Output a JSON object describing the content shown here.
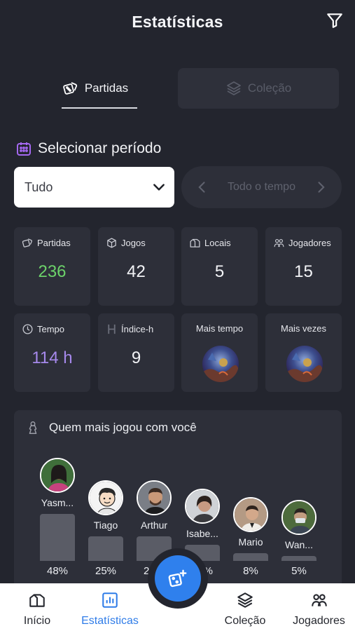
{
  "header": {
    "title": "Estatísticas"
  },
  "tabs": [
    {
      "label": "Partidas",
      "icon": "dice-icon",
      "active": true
    },
    {
      "label": "Coleção",
      "icon": "layers-icon",
      "active": false
    }
  ],
  "period": {
    "label": "Selecionar período",
    "select_value": "Tudo",
    "range_label": "Todo o tempo"
  },
  "stats": [
    {
      "label": "Partidas",
      "value": "236",
      "icon": "dice-icon",
      "color": "#6cd26a"
    },
    {
      "label": "Jogos",
      "value": "42",
      "icon": "box-icon"
    },
    {
      "label": "Locais",
      "value": "5",
      "icon": "location-icon"
    },
    {
      "label": "Jogadores",
      "value": "15",
      "icon": "players-icon"
    },
    {
      "label": "Tempo",
      "value": "114 h",
      "icon": "clock-icon",
      "color": "#a689ec"
    },
    {
      "label": "Índice-h",
      "value": "9",
      "icon": "h-icon"
    },
    {
      "label": "Mais tempo",
      "icon": "game-cover-image"
    },
    {
      "label": "Mais vezes",
      "icon": "game-cover-image"
    }
  ],
  "top_players": {
    "title": "Quem mais jogou com você",
    "players": [
      {
        "name": "Yasm...",
        "percent": "48%",
        "share": 0.48
      },
      {
        "name": "Tiago",
        "percent": "25%",
        "share": 0.25
      },
      {
        "name": "Arthur",
        "percent": "25%",
        "share": 0.25
      },
      {
        "name": "Isabe...",
        "percent": "16%",
        "share": 0.16
      },
      {
        "name": "Mario",
        "percent": "8%",
        "share": 0.08
      },
      {
        "name": "Wan...",
        "percent": "5%",
        "share": 0.05
      }
    ]
  },
  "bottom_nav": [
    {
      "label": "Início",
      "icon": "home-icon",
      "active": false
    },
    {
      "label": "Estatísticas",
      "icon": "chart-icon",
      "active": true
    },
    {
      "label": "Coleção",
      "icon": "layers-icon",
      "active": false
    },
    {
      "label": "Jogadores",
      "icon": "players-icon",
      "active": false
    }
  ],
  "fab": {
    "icon": "add-match-icon"
  },
  "colors": {
    "accent": "#2f7ce8",
    "background": "#23252e",
    "card": "#2d2f39",
    "green": "#6cd26a",
    "purple": "#a689ec"
  }
}
